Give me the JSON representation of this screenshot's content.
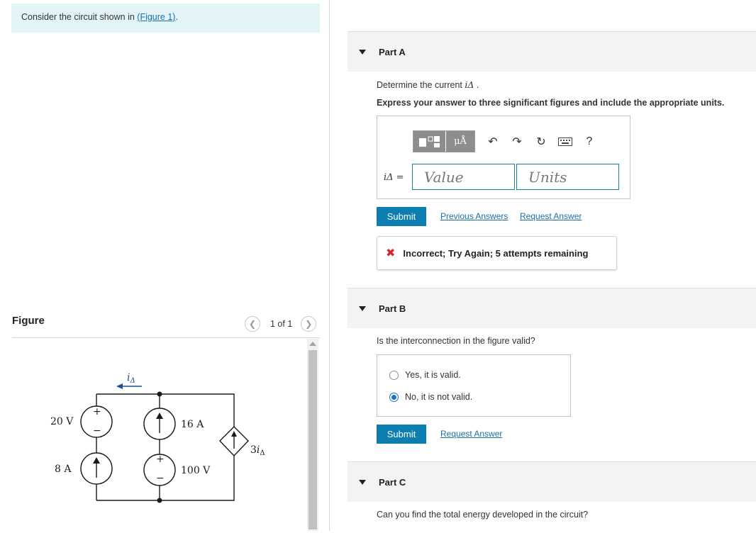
{
  "intro": {
    "text_before": "Consider the circuit shown in ",
    "figure_link": "(Figure 1)",
    "text_after": "."
  },
  "figure_panel": {
    "title": "Figure",
    "pager_text": "1 of 1",
    "prev_icon": "chevron-left-icon",
    "next_icon": "chevron-right-icon"
  },
  "circuit": {
    "current_label": "i",
    "current_sub": "Δ",
    "v_source_left": "20 V",
    "i_source_left": "8 A",
    "i_source_mid": "16 A",
    "v_source_mid": "100 V",
    "dep_source_coeff": "3",
    "dep_source_var": "i",
    "dep_source_sub": "Δ",
    "plus": "+",
    "minus": "−"
  },
  "part_a": {
    "label": "Part A",
    "question_prefix": "Determine the current ",
    "question_var": "iΔ",
    "question_suffix": " .",
    "instruction": "Express your answer to three significant figures and include the appropriate units.",
    "toolbar": {
      "units_btn": "μÅ",
      "help": "?",
      "icons": [
        "templates-icon",
        "units-icon",
        "undo-icon",
        "redo-icon",
        "reset-icon",
        "keyboard-icon",
        "help-icon"
      ]
    },
    "var_label": "iΔ =",
    "value_placeholder": "Value",
    "units_placeholder": "Units",
    "submit": "Submit",
    "previous_answers": "Previous Answers",
    "request_answer": "Request Answer",
    "feedback": "Incorrect; Try Again; 5 attempts remaining",
    "feedback_icon": "x-icon"
  },
  "part_b": {
    "label": "Part B",
    "question": "Is the interconnection in the figure valid?",
    "options": [
      {
        "label": "Yes, it is valid.",
        "checked": false
      },
      {
        "label": "No, it is not valid.",
        "checked": true
      }
    ],
    "submit": "Submit",
    "request_answer": "Request Answer"
  },
  "part_c": {
    "label": "Part C",
    "question": "Can you find the total energy developed in the circuit?"
  },
  "colors": {
    "accent": "#0c7eaf",
    "link": "#1a6fa8",
    "intro_bg": "#e3f4f6",
    "error": "#d4282c",
    "radio": "#1a6fd1"
  }
}
